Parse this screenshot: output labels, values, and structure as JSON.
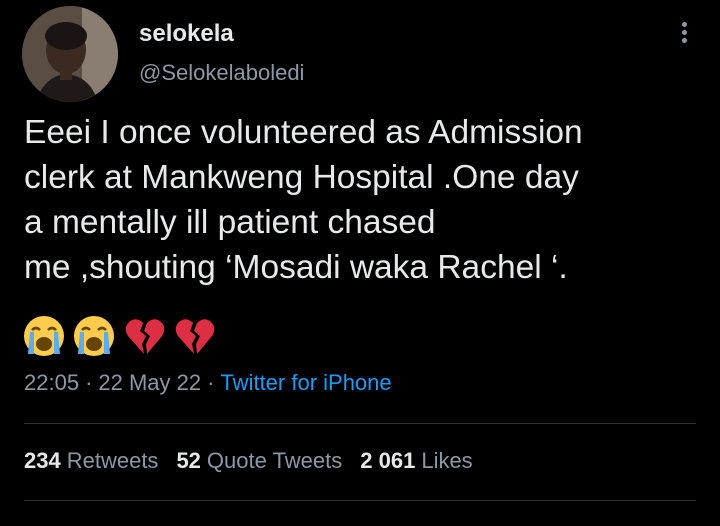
{
  "author": {
    "display_name": "selokela",
    "handle": "@Selokelaboledi"
  },
  "tweet": {
    "lines": [
      "Eeei I once volunteered as Admission",
      "clerk at Mankweng Hospital .One day",
      "a mentally ill patient chased",
      "me ,shouting ‘Mosadi waka Rachel ‘."
    ],
    "emojis": [
      "loudly-crying-face",
      "loudly-crying-face",
      "broken-heart",
      "broken-heart"
    ]
  },
  "meta": {
    "time": "22:05",
    "date": "22 May 22",
    "separator": "·",
    "source": "Twitter for iPhone"
  },
  "stats": {
    "retweets_count": "234",
    "retweets_label": "Retweets",
    "quotes_count": "52",
    "quotes_label": "Quote Tweets",
    "likes_count": "2 061",
    "likes_label": "Likes"
  },
  "colors": {
    "background": "#000000",
    "text_primary": "#e7e9ea",
    "text_secondary": "#8b98a5",
    "link": "#1d9bf0",
    "divider": "#2f3336"
  }
}
